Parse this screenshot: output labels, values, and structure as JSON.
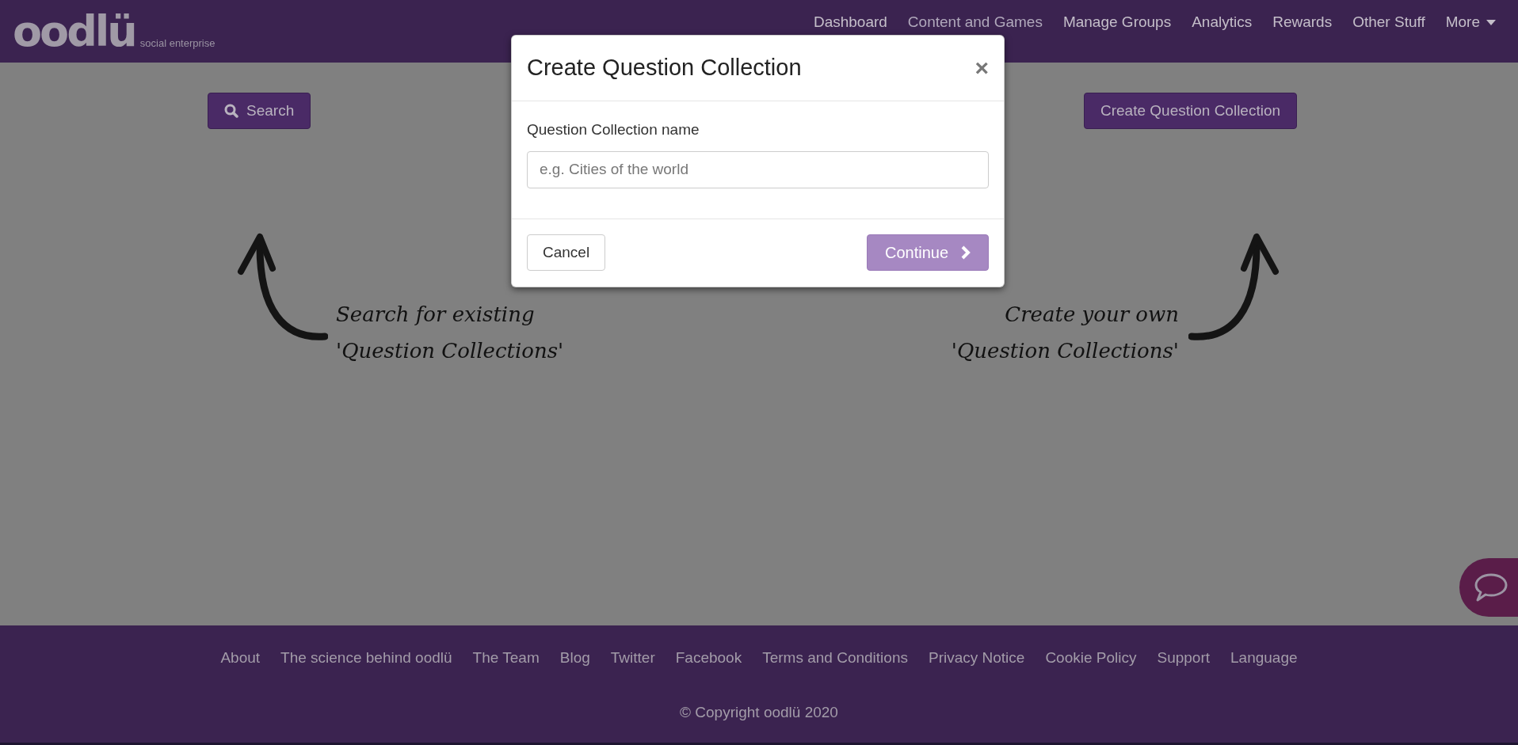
{
  "header": {
    "logo": {
      "wordmark": "oodlü",
      "tagline": "social enterprise"
    },
    "nav": [
      {
        "label": "Dashboard",
        "kind": "link"
      },
      {
        "label": "Content and Games",
        "kind": "link"
      },
      {
        "label": "Manage Groups",
        "kind": "link"
      },
      {
        "label": "Analytics",
        "kind": "link"
      },
      {
        "label": "Rewards",
        "kind": "link"
      },
      {
        "label": "Other Stuff",
        "kind": "link"
      },
      {
        "label": "More",
        "kind": "dropdown"
      }
    ]
  },
  "toolbar": {
    "search_button": "Search",
    "create_button": "Create Question Collection"
  },
  "hints": [
    {
      "lines": [
        "Search for existing",
        "'Question Collections'"
      ]
    },
    {
      "lines": [
        "Create your own",
        "'Question Collections'"
      ]
    }
  ],
  "modal": {
    "title": "Create Question Collection",
    "close": "×",
    "field_label": "Question Collection name",
    "placeholder": "e.g. Cities of the world",
    "cancel": "Cancel",
    "continue": "Continue"
  },
  "footer": {
    "links": [
      "About",
      "The science behind oodlü",
      "The Team",
      "Blog",
      "Twitter",
      "Facebook",
      "Terms and Conditions",
      "Privacy Notice",
      "Cookie Policy",
      "Support",
      "Language"
    ],
    "copyright": "© Copyright oodlü 2020"
  }
}
